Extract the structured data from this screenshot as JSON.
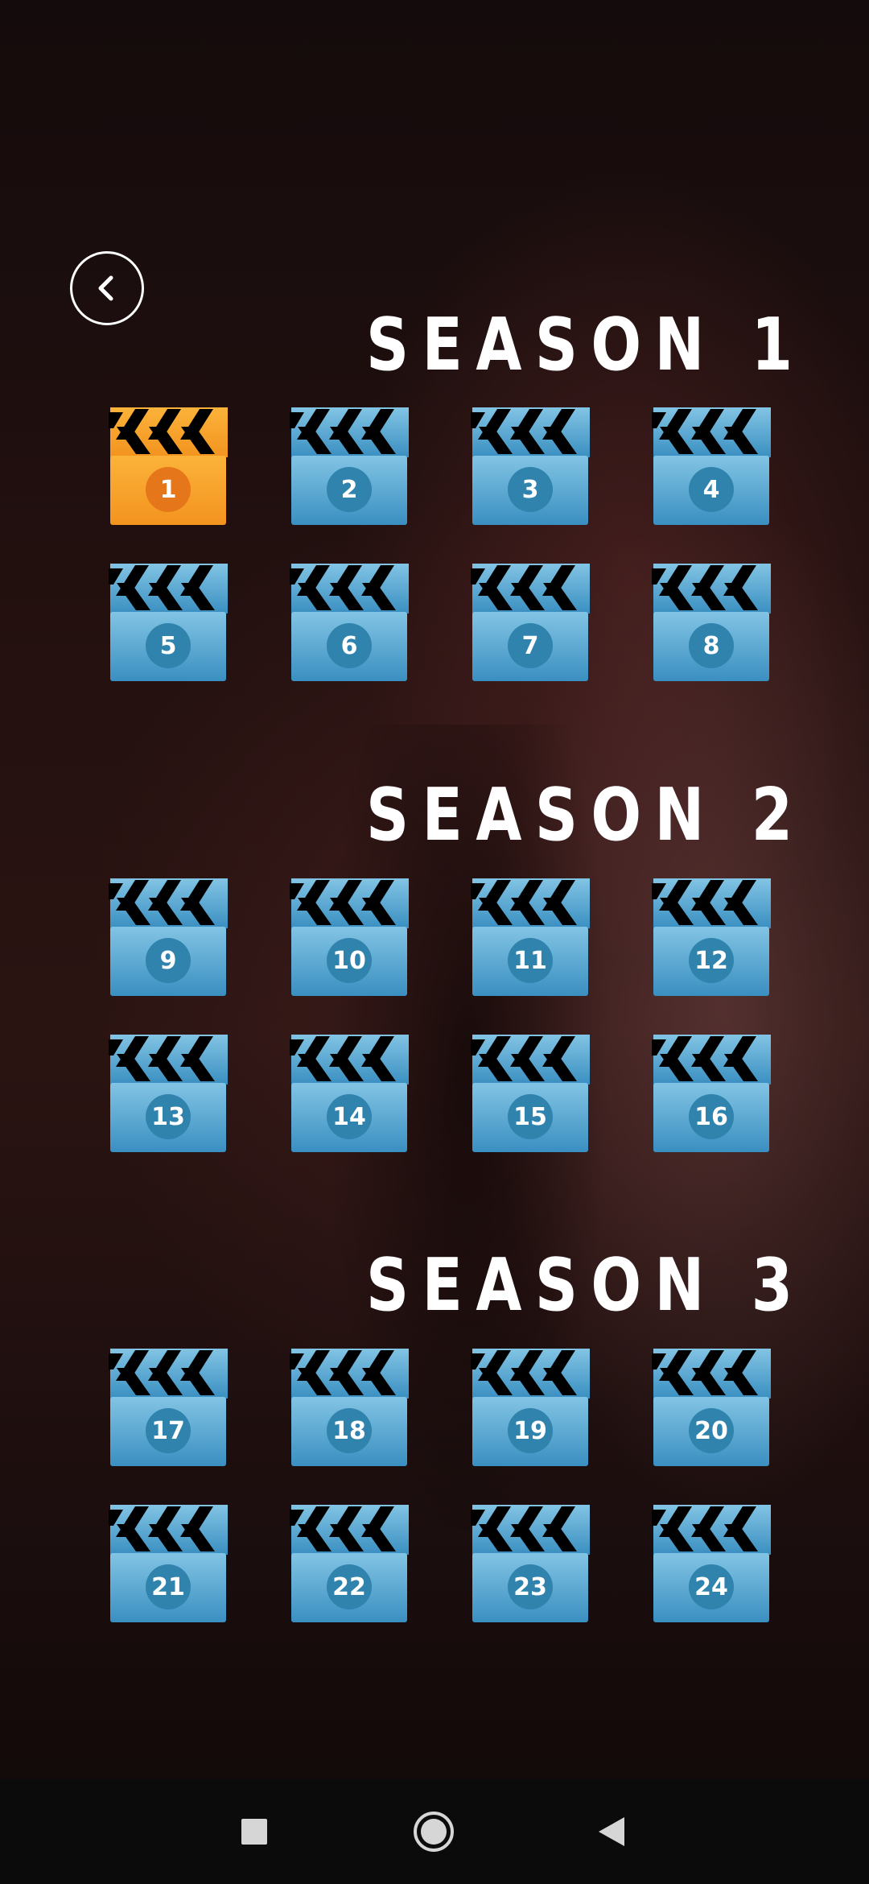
{
  "back_button": {
    "icon": "chevron-left-icon"
  },
  "seasons": [
    {
      "title": "SEASON 1",
      "episodes": [
        "1",
        "2",
        "3",
        "4",
        "5",
        "6",
        "7",
        "8"
      ],
      "selected": "1"
    },
    {
      "title": "SEASON 2",
      "episodes": [
        "9",
        "10",
        "11",
        "12",
        "13",
        "14",
        "15",
        "16"
      ]
    },
    {
      "title": "SEASON 3",
      "episodes": [
        "17",
        "18",
        "19",
        "20",
        "21",
        "22",
        "23",
        "24"
      ]
    }
  ],
  "colors": {
    "tile_blue_top": "#82c4e4",
    "tile_blue_bottom": "#3a8fc1",
    "tile_orange_top": "#fbb33a",
    "tile_orange_bottom": "#f3931f",
    "badge_blue": "#2f83ad",
    "badge_orange": "#e6761a"
  },
  "navbar": {
    "icons": [
      "square-recents-icon",
      "circle-home-icon",
      "triangle-back-icon"
    ]
  }
}
